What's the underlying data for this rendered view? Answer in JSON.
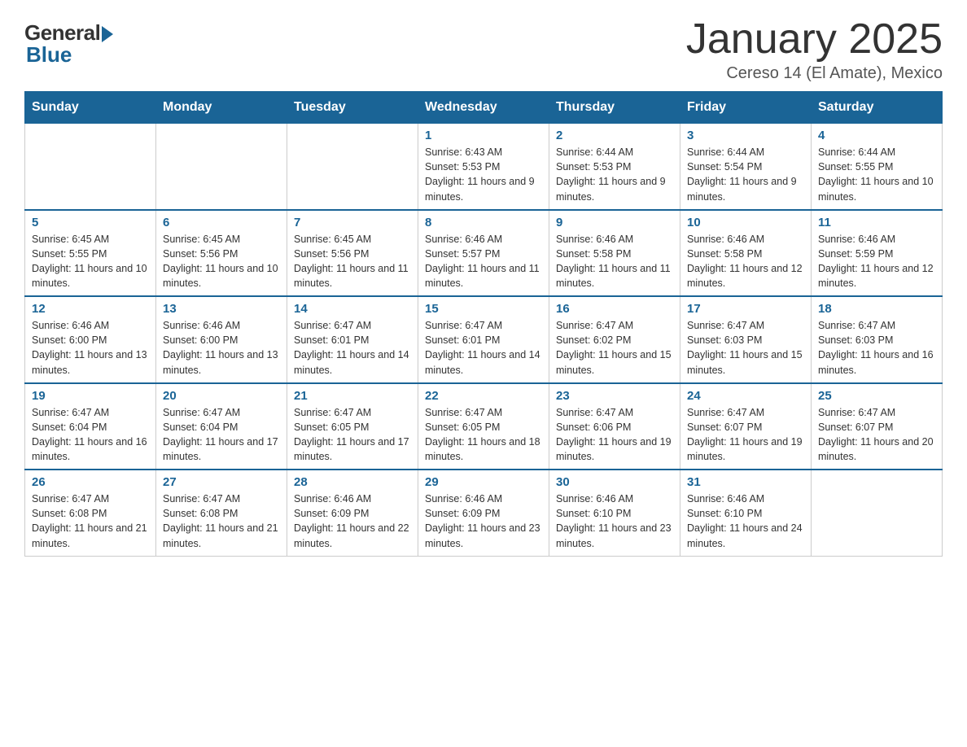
{
  "logo": {
    "general": "General",
    "blue": "Blue"
  },
  "header": {
    "title": "January 2025",
    "subtitle": "Cereso 14 (El Amate), Mexico"
  },
  "columns": [
    "Sunday",
    "Monday",
    "Tuesday",
    "Wednesday",
    "Thursday",
    "Friday",
    "Saturday"
  ],
  "weeks": [
    [
      {
        "day": "",
        "info": ""
      },
      {
        "day": "",
        "info": ""
      },
      {
        "day": "",
        "info": ""
      },
      {
        "day": "1",
        "info": "Sunrise: 6:43 AM\nSunset: 5:53 PM\nDaylight: 11 hours and 9 minutes."
      },
      {
        "day": "2",
        "info": "Sunrise: 6:44 AM\nSunset: 5:53 PM\nDaylight: 11 hours and 9 minutes."
      },
      {
        "day": "3",
        "info": "Sunrise: 6:44 AM\nSunset: 5:54 PM\nDaylight: 11 hours and 9 minutes."
      },
      {
        "day": "4",
        "info": "Sunrise: 6:44 AM\nSunset: 5:55 PM\nDaylight: 11 hours and 10 minutes."
      }
    ],
    [
      {
        "day": "5",
        "info": "Sunrise: 6:45 AM\nSunset: 5:55 PM\nDaylight: 11 hours and 10 minutes."
      },
      {
        "day": "6",
        "info": "Sunrise: 6:45 AM\nSunset: 5:56 PM\nDaylight: 11 hours and 10 minutes."
      },
      {
        "day": "7",
        "info": "Sunrise: 6:45 AM\nSunset: 5:56 PM\nDaylight: 11 hours and 11 minutes."
      },
      {
        "day": "8",
        "info": "Sunrise: 6:46 AM\nSunset: 5:57 PM\nDaylight: 11 hours and 11 minutes."
      },
      {
        "day": "9",
        "info": "Sunrise: 6:46 AM\nSunset: 5:58 PM\nDaylight: 11 hours and 11 minutes."
      },
      {
        "day": "10",
        "info": "Sunrise: 6:46 AM\nSunset: 5:58 PM\nDaylight: 11 hours and 12 minutes."
      },
      {
        "day": "11",
        "info": "Sunrise: 6:46 AM\nSunset: 5:59 PM\nDaylight: 11 hours and 12 minutes."
      }
    ],
    [
      {
        "day": "12",
        "info": "Sunrise: 6:46 AM\nSunset: 6:00 PM\nDaylight: 11 hours and 13 minutes."
      },
      {
        "day": "13",
        "info": "Sunrise: 6:46 AM\nSunset: 6:00 PM\nDaylight: 11 hours and 13 minutes."
      },
      {
        "day": "14",
        "info": "Sunrise: 6:47 AM\nSunset: 6:01 PM\nDaylight: 11 hours and 14 minutes."
      },
      {
        "day": "15",
        "info": "Sunrise: 6:47 AM\nSunset: 6:01 PM\nDaylight: 11 hours and 14 minutes."
      },
      {
        "day": "16",
        "info": "Sunrise: 6:47 AM\nSunset: 6:02 PM\nDaylight: 11 hours and 15 minutes."
      },
      {
        "day": "17",
        "info": "Sunrise: 6:47 AM\nSunset: 6:03 PM\nDaylight: 11 hours and 15 minutes."
      },
      {
        "day": "18",
        "info": "Sunrise: 6:47 AM\nSunset: 6:03 PM\nDaylight: 11 hours and 16 minutes."
      }
    ],
    [
      {
        "day": "19",
        "info": "Sunrise: 6:47 AM\nSunset: 6:04 PM\nDaylight: 11 hours and 16 minutes."
      },
      {
        "day": "20",
        "info": "Sunrise: 6:47 AM\nSunset: 6:04 PM\nDaylight: 11 hours and 17 minutes."
      },
      {
        "day": "21",
        "info": "Sunrise: 6:47 AM\nSunset: 6:05 PM\nDaylight: 11 hours and 17 minutes."
      },
      {
        "day": "22",
        "info": "Sunrise: 6:47 AM\nSunset: 6:05 PM\nDaylight: 11 hours and 18 minutes."
      },
      {
        "day": "23",
        "info": "Sunrise: 6:47 AM\nSunset: 6:06 PM\nDaylight: 11 hours and 19 minutes."
      },
      {
        "day": "24",
        "info": "Sunrise: 6:47 AM\nSunset: 6:07 PM\nDaylight: 11 hours and 19 minutes."
      },
      {
        "day": "25",
        "info": "Sunrise: 6:47 AM\nSunset: 6:07 PM\nDaylight: 11 hours and 20 minutes."
      }
    ],
    [
      {
        "day": "26",
        "info": "Sunrise: 6:47 AM\nSunset: 6:08 PM\nDaylight: 11 hours and 21 minutes."
      },
      {
        "day": "27",
        "info": "Sunrise: 6:47 AM\nSunset: 6:08 PM\nDaylight: 11 hours and 21 minutes."
      },
      {
        "day": "28",
        "info": "Sunrise: 6:46 AM\nSunset: 6:09 PM\nDaylight: 11 hours and 22 minutes."
      },
      {
        "day": "29",
        "info": "Sunrise: 6:46 AM\nSunset: 6:09 PM\nDaylight: 11 hours and 23 minutes."
      },
      {
        "day": "30",
        "info": "Sunrise: 6:46 AM\nSunset: 6:10 PM\nDaylight: 11 hours and 23 minutes."
      },
      {
        "day": "31",
        "info": "Sunrise: 6:46 AM\nSunset: 6:10 PM\nDaylight: 11 hours and 24 minutes."
      },
      {
        "day": "",
        "info": ""
      }
    ]
  ]
}
